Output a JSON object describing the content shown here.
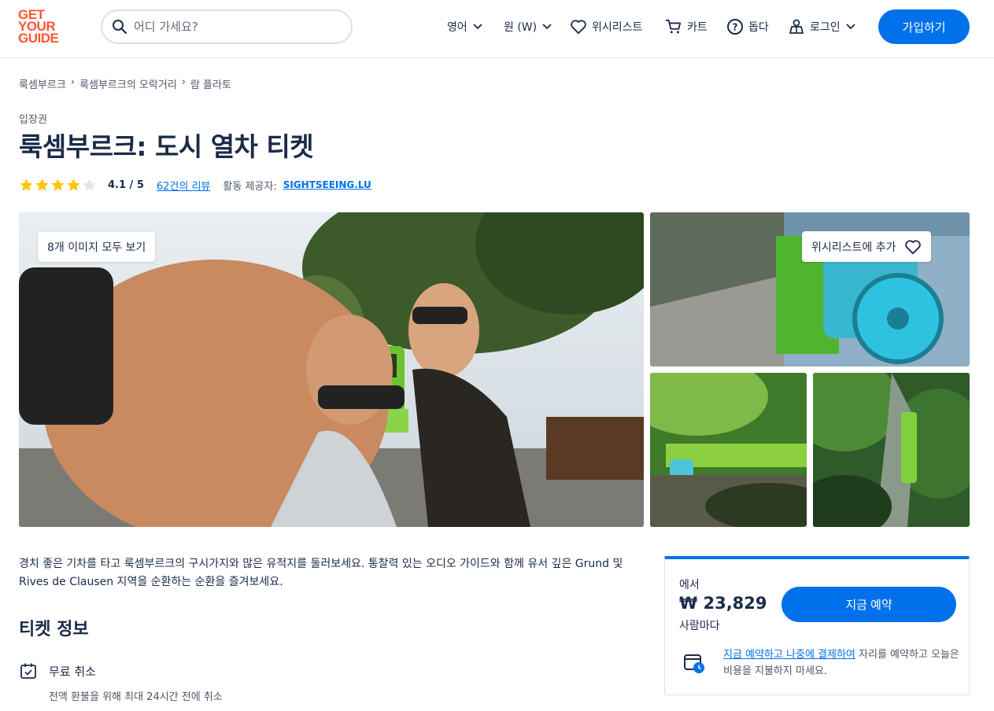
{
  "colors": {
    "brand": "#ff5533",
    "accent": "#0071eb",
    "text": "#1a2b49",
    "star": "#fdc500"
  },
  "header": {
    "logo": [
      "GET",
      "YOUR",
      "GUIDE"
    ],
    "search_placeholder": "어디 가세요?",
    "language": "영어",
    "currency": "원 (W)",
    "wishlist": "위시리스트",
    "cart": "카트",
    "help": "돕다",
    "login": "로그인",
    "signup": "가입하기"
  },
  "breadcrumb": [
    "룩셈부르크",
    "룩셈부르크의 오락거리",
    "람 플라토"
  ],
  "category": "입장권",
  "title": "룩셈부르크: 도시 열차 티켓",
  "rating": {
    "value": 4.1,
    "label": "4.1 / 5",
    "stars_filled": 4,
    "stars_total": 5,
    "reviews": "62건의 리뷰"
  },
  "provider": {
    "label": "활동 제공자:",
    "name": "SIGHTSEEING.LU"
  },
  "gallery": {
    "view_all": "8개 이미지 모두 보기",
    "wishlist_add": "위시리스트에 추가"
  },
  "description": "경치 좋은 기차를 타고 룩셈부르크의 구시가지와 많은 유적지를 둘러보세요. 통찰력 있는 오디오 가이드와 함께 유서 깊은 Grund 및 Rives de Clausen 지역을 순환하는 순환을 즐겨보세요.",
  "ticket_info": {
    "title": "티켓 정보",
    "free_cancel": "무료 취소",
    "free_cancel_sub": "전액 환불을 위해 최대 24시간 전에 취소"
  },
  "booking": {
    "from": "에서",
    "price": "₩ 23,829",
    "per": "사람마다",
    "button": "지금 예약",
    "rnpl_link": "지금 예약하고 나중에 결제하여",
    "rnpl_rest": " 자리를 예약하고 오늘은 비용을 지불하지 마세요."
  }
}
